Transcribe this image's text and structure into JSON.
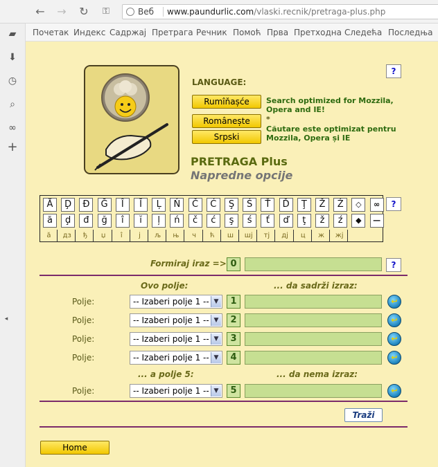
{
  "browser": {
    "search_label": "Веб",
    "url_domain": "www.paundurlic.com",
    "url_path": "/vlaski.recnik/pretraga-plus.php"
  },
  "menu": [
    "Почетак",
    "Индекс",
    "Садржај",
    "Претрага",
    "Речник",
    "Помоћ",
    "Прва",
    "Претходна",
    "Следећа",
    "Последња"
  ],
  "language": {
    "label": "LANGUAGE:",
    "buttons": [
      "Rumîňașće",
      "Românește",
      "Srpski"
    ],
    "note_en": "Search optimized for Mozzila, Opera and IE!",
    "note_star": "*",
    "note_ro": "Căutare este optimizat pentru Mozzila, Opera și IE"
  },
  "brand": {
    "title": "PRETRAGA Plus",
    "subtitle": "Napredne opcije"
  },
  "help_label": "?",
  "keyboard": {
    "upper": [
      "Ă",
      "Ḑ",
      "Đ",
      "Ğ",
      "Î",
      "Ĭ",
      "Ļ",
      "Ń",
      "Č",
      "Ć",
      "Ş",
      "Ś",
      "Ť",
      "Ď",
      "Ţ",
      "Ž",
      "Ź",
      "◇",
      "∞"
    ],
    "lower": [
      "ă",
      "ḑ",
      "đ",
      "ğ",
      "î",
      "ĭ",
      "ļ",
      "ń",
      "č",
      "ć",
      "ş",
      "ś",
      "ť",
      "ď",
      "ţ",
      "ž",
      "ź",
      "◆",
      "—"
    ],
    "cyrillic": [
      "ă",
      "дз",
      "ђ",
      "џ",
      "î",
      "j",
      "љ",
      "њ",
      "ч",
      "ћ",
      "ш",
      "шj",
      "тj",
      "дj",
      "ц",
      "ж",
      "жj"
    ]
  },
  "form": {
    "formiraj_label": "Formiraj iraz =>",
    "col_field": "Ovo polje:",
    "col_contains": "... da sadrži izraz:",
    "field_label": "Polje:",
    "select_placeholder": "-- Izaberi polje 1 --",
    "col_field5": "... a polje 5:",
    "col_not_contains": "... da nema izraz:",
    "numbers": [
      "0",
      "1",
      "2",
      "3",
      "4",
      "5"
    ],
    "search_button": "Traži",
    "home_button": "Home"
  },
  "colors": {
    "page_bg": "#faf0b8",
    "button_yellow": "#f2c800",
    "input_green": "#c6df92",
    "divider": "#7a2a6a"
  }
}
